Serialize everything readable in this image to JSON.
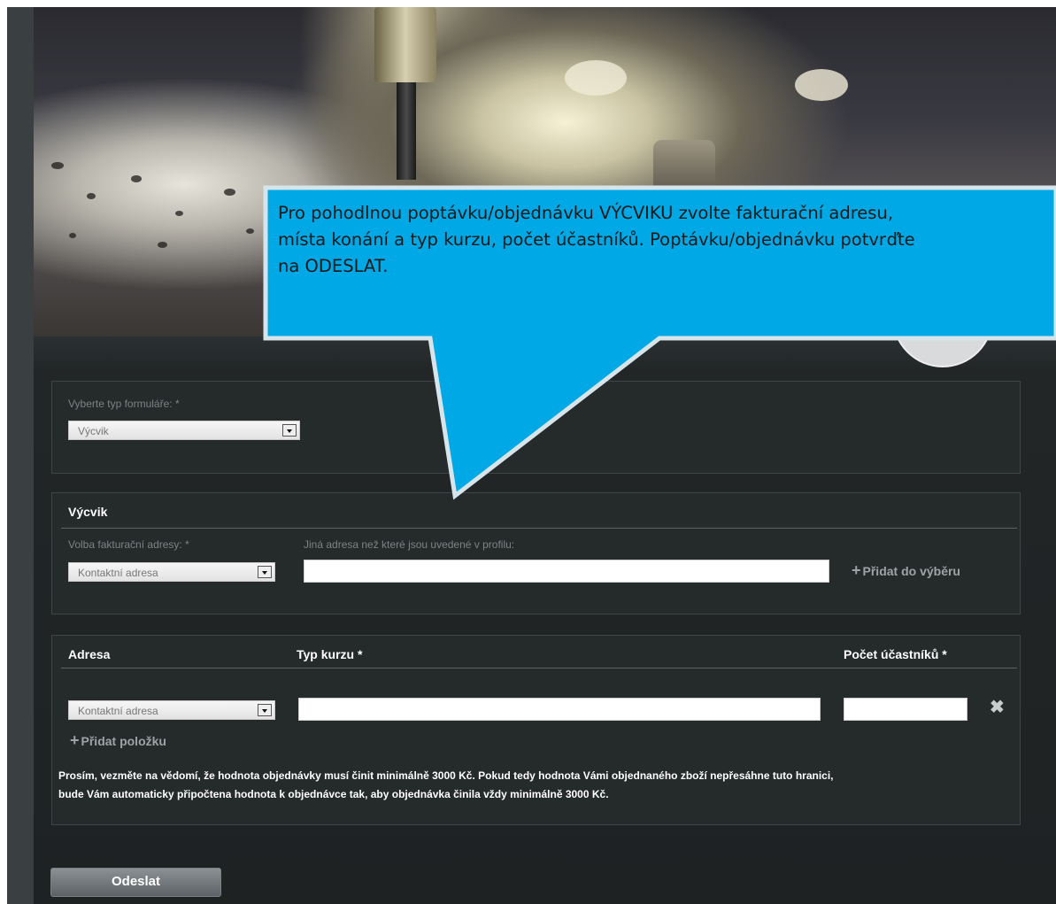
{
  "callout": {
    "line1": "Pro pohodlnou poptávku/objednávku VÝCVIKU zvolte fakturační adresu,",
    "line2": "místa konání a typ kurzu, počet účastníků. Poptávku/objednávku potvrďte",
    "line3": "na ODESLAT.",
    "color": "#00a8e6"
  },
  "form_type": {
    "label": "Vyberte typ formuláře: *",
    "selected": "Výcvik"
  },
  "billing": {
    "section_title": "Výcvik",
    "address_label": "Volba fakturační adresy: *",
    "address_selected": "Kontaktní adresa",
    "other_label": "Jiná adresa než které jsou uvedené v profilu:",
    "other_value": "",
    "add_label": "Přidat do výběru"
  },
  "items": {
    "columns": [
      "Adresa",
      "Typ kurzu *",
      "Počet účastníků *"
    ],
    "row_address": "Kontaktní adresa",
    "row_course": "",
    "row_count": "",
    "add_label": "Přidat položku"
  },
  "note": {
    "line1": "Prosím, vezměte na vědomí, že hodnota objednávky musí činit minimálně 3000 Kč. Pokud tedy hodnota Vámi objednaného zboží nepřesáhne tuto hranici,",
    "line2": "bude Vám automaticky připočtena hodnota k objednávce tak, aby objednávka činila vždy minimálně 3000 Kč."
  },
  "submit_label": "Odeslat"
}
